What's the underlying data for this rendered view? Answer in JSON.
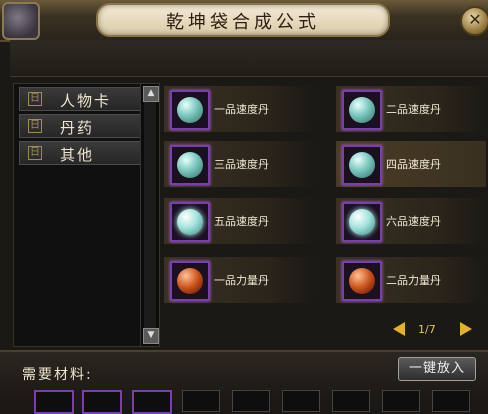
{
  "window": {
    "title": "乾坤袋合成公式",
    "close_icon": "close-icon"
  },
  "categories": [
    {
      "marker": "日",
      "label": "人物卡"
    },
    {
      "marker": "日",
      "label": "丹药"
    },
    {
      "marker": "日",
      "label": "其他"
    }
  ],
  "scroll": {
    "up": "▲",
    "down": "▼"
  },
  "recipes": [
    {
      "name": "一品速度丹",
      "icon": "teal-pill-icon"
    },
    {
      "name": "二品速度丹",
      "icon": "teal-pill-icon"
    },
    {
      "name": "三品速度丹",
      "icon": "teal-pill-icon"
    },
    {
      "name": "四品速度丹",
      "icon": "teal-pill-icon"
    },
    {
      "name": "五品速度丹",
      "icon": "teal-pill-icon"
    },
    {
      "name": "六品速度丹",
      "icon": "teal-pill-icon"
    },
    {
      "name": "一品力量丹",
      "icon": "red-pill-icon"
    },
    {
      "name": "二品力量丹",
      "icon": "red-pill-icon"
    }
  ],
  "pagination": {
    "text": "1/7"
  },
  "materials": {
    "label": "需要材料:",
    "button": "一键放入"
  },
  "colors": {
    "accent_gold": "#e3b12a",
    "slot_purple": "#7a3fa8"
  }
}
